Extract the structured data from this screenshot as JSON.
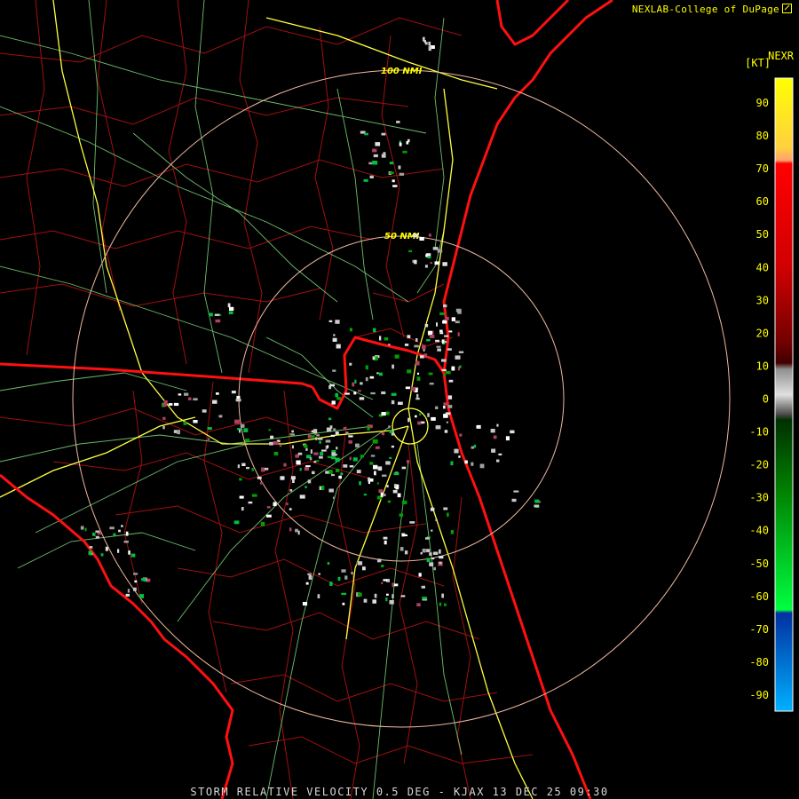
{
  "header": {
    "credit": "NEXLAB-College of DuPage",
    "product": "NEXR",
    "unit": "[KT]"
  },
  "footer": {
    "caption": "STORM RELATIVE VELOCITY 0.5 DEG - KJAX 13 DEC 25 09:30"
  },
  "range_rings": [
    {
      "label": "50 NMI"
    },
    {
      "label": "100 NMI"
    }
  ],
  "legend": {
    "ticks": [
      "90",
      "80",
      "70",
      "60",
      "50",
      "40",
      "30",
      "20",
      "10",
      "0",
      "-10",
      "-20",
      "-30",
      "-40",
      "-50",
      "-60",
      "-70",
      "-80",
      "-90"
    ],
    "colors": {
      "top": "#ffff00",
      "orange": "#ffa050",
      "red": "#ff0000",
      "darkred": "#8b0000",
      "gray": "#b0b0b0",
      "darkgreen": "#006400",
      "green": "#00e040",
      "darkblue": "#0030a0",
      "blue": "#00a0ff"
    }
  },
  "map_colors": {
    "state_border": "#ff1010",
    "county": "#b01010",
    "roads": "#90ee90",
    "interstate": "#ffff40",
    "rings": "#f0b8a0"
  }
}
